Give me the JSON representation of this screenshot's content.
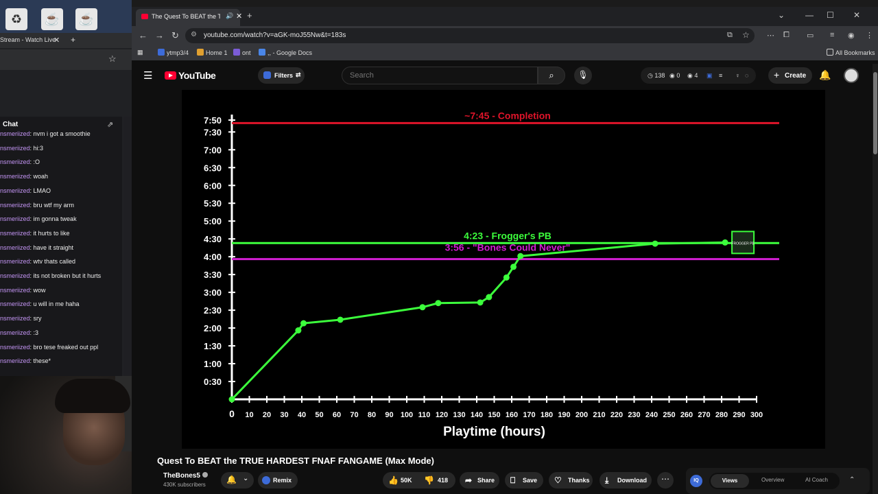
{
  "desktop": {
    "icons": [
      "recycle-bin",
      "java-1",
      "java-2"
    ]
  },
  "left_browser": {
    "tab_title": "Stream - Watch Live",
    "chat_title": "Chat",
    "chat_messages": [
      {
        "user": "nsmeriized",
        "text": "nvm i got a smoothie"
      },
      {
        "user": "nsmeriized",
        "text": "hi:3"
      },
      {
        "user": "nsmeriized",
        "text": ":O"
      },
      {
        "user": "nsmeriized",
        "text": "woah"
      },
      {
        "user": "nsmeriized",
        "text": "LMAO"
      },
      {
        "user": "nsmeriized",
        "text": "bru wtf my arm"
      },
      {
        "user": "nsmeriized",
        "text": "im gonna tweak"
      },
      {
        "user": "nsmeriized",
        "text": "it hurts to like"
      },
      {
        "user": "nsmeriized",
        "text": "have it straight"
      },
      {
        "user": "nsmeriized",
        "text": "wtv thats called"
      },
      {
        "user": "nsmeriized",
        "text": "its not broken but it hurts"
      },
      {
        "user": "nsmeriized",
        "text": "wow"
      },
      {
        "user": "nsmeriized",
        "text": "u will in me haha"
      },
      {
        "user": "nsmeriized",
        "text": "sry"
      },
      {
        "user": "nsmeriized",
        "text": ":3"
      },
      {
        "user": "nsmeriized",
        "text": "bro tese freaked out ppl"
      },
      {
        "user": "nsmeriized",
        "text": "these*"
      }
    ]
  },
  "browser": {
    "tab_title": "The Quest To BEAT the TRUE",
    "url": "youtube.com/watch?v=aGK-moJ55Nw&t=183s",
    "bookmarks": [
      {
        "label": "ytmp3/4",
        "color": "#3d6bd8"
      },
      {
        "label": "Home 1",
        "color": "#e0a030"
      },
      {
        "label": "ont",
        "color": "#7b5cd6"
      },
      {
        "label": ",, - Google Docs",
        "color": "#4a86e8"
      }
    ],
    "all_bookmarks": "All Bookmarks"
  },
  "youtube": {
    "logo": "YouTube",
    "filters_label": "Filters",
    "search_placeholder": "Search",
    "stats": {
      "a": "138",
      "b": "0",
      "c": "4"
    },
    "create_label": "Create",
    "video_title": "Quest To BEAT the TRUE HARDEST FNAF FANGAME (Max Mode)",
    "channel": "TheBones5",
    "subscribers": "430K subscribers",
    "remix_label": "Remix",
    "likes": "50K",
    "dislikes": "418",
    "share_label": "Share",
    "save_label": "Save",
    "thanks_label": "Thanks",
    "download_label": "Download",
    "iq_tabs": [
      "Views",
      "Overview",
      "AI Coach"
    ]
  },
  "chart_data": {
    "type": "line",
    "xlabel": "Playtime (hours)",
    "ylabel": "",
    "x_ticks": [
      0,
      10,
      20,
      30,
      40,
      50,
      60,
      70,
      80,
      90,
      100,
      110,
      120,
      130,
      140,
      150,
      160,
      170,
      180,
      190,
      200,
      210,
      220,
      230,
      240,
      250,
      260,
      270,
      280,
      290,
      300
    ],
    "y_tick_labels": [
      "0:30",
      "1:00",
      "1:30",
      "2:00",
      "2:30",
      "3:00",
      "3:30",
      "4:00",
      "4:30",
      "5:00",
      "5:30",
      "6:00",
      "6:30",
      "7:00",
      "7:30",
      "7:50"
    ],
    "y_tick_minutes": [
      30,
      60,
      90,
      120,
      150,
      180,
      210,
      240,
      270,
      300,
      330,
      360,
      390,
      420,
      450,
      470
    ],
    "xlim": [
      0,
      300
    ],
    "ylim": [
      0,
      470
    ],
    "series": [
      {
        "color": "#3cff3c",
        "x": [
          0,
          38,
          41,
          62,
          109,
          118,
          142,
          147,
          157,
          161,
          165,
          242,
          282
        ],
        "y": [
          0,
          116,
          128,
          134,
          155,
          162,
          163,
          172,
          205,
          223,
          241,
          262,
          264
        ]
      }
    ],
    "reference_lines": [
      {
        "label": "~7:45 - Completion",
        "y": 465,
        "color": "#e0142a"
      },
      {
        "label": "4:23 - Frogger's PB",
        "y": 263,
        "color": "#3cff3c"
      },
      {
        "label": "3:56 - \"Bones Could Never\"",
        "y": 236,
        "color": "#d21ed2"
      }
    ],
    "marker_label": "FROGGER PB"
  }
}
